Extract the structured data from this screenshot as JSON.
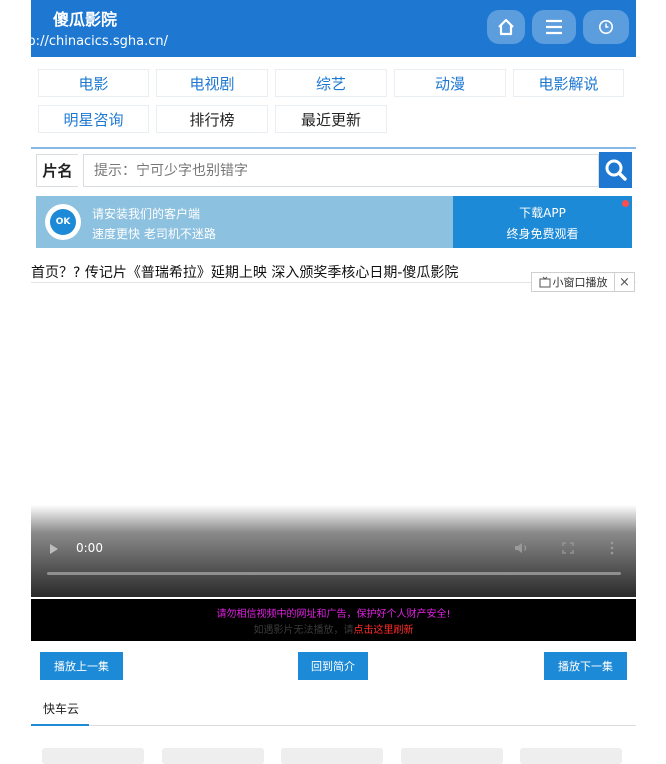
{
  "header": {
    "site_name": "傻瓜影院",
    "site_url": "http://chinacics.sgha.cn/",
    "icons": [
      "home-icon",
      "menu-icon",
      "history-icon"
    ]
  },
  "nav": {
    "items": [
      "电影",
      "电视剧",
      "综艺",
      "动漫",
      "电影解说",
      "明星咨询",
      "排行榜",
      "最近更新"
    ]
  },
  "search": {
    "label": "片名",
    "placeholder": "提示：宁可少字也别错字"
  },
  "app_banner": {
    "line1": "请安装我们的客户端",
    "line2": "速度更快 老司机不迷路",
    "cta_title": "下载APP",
    "cta_sub": "终身免费观看"
  },
  "breadcrumb": {
    "text": "首页？? 传记片《普瑞希拉》延期上映 深入颁奖季核心日期-傻瓜影院"
  },
  "mini_player": {
    "label": "小窗口播放",
    "close": "×"
  },
  "player": {
    "time": "0:00",
    "progress": 0
  },
  "notice": {
    "line1": "请勿相信视频中的网址和广告，保护好个人财产安全!",
    "line2_prefix": "如遇影片无法播放，请",
    "line2_link": "点击这里刷新"
  },
  "episode_controls": {
    "prev": "播放上一集",
    "intro": "回到简介",
    "next": "播放下一集"
  },
  "source_tabs": {
    "active": "快车云"
  },
  "colors": {
    "brand": "#1e78d2",
    "notice_pink": "#e020e0",
    "notice_red": "#ff2a2a"
  }
}
